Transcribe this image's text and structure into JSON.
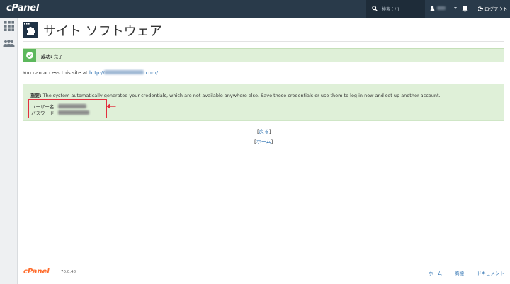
{
  "topbar": {
    "logo": "cPanel",
    "search_placeholder": "検索 ( / )",
    "logout_label": "ログアウト"
  },
  "page": {
    "title": "サイト ソフトウェア"
  },
  "alert_success": {
    "label": "成功:",
    "text": "完了"
  },
  "access": {
    "prefix": "You can access this site at ",
    "url_start": "http://",
    "url_end": ".com/"
  },
  "credentials": {
    "important_label": "重要:",
    "message": "The system automatically generated your credentials, which are not available anywhere else. Save these credentials or use them to log in now and set up another account.",
    "username_label": "ユーザー名:",
    "password_label": "パスワード:"
  },
  "links": {
    "back": "戻る",
    "home": "ホーム"
  },
  "footer": {
    "logo": "cPanel",
    "version": "70.0.48",
    "links": [
      "ホーム",
      "商標",
      "ドキュメント"
    ]
  },
  "colors": {
    "topbar": "#293a4a",
    "success_green": "#dff0d8",
    "highlight_red": "#e2303f",
    "link_blue": "#2a6fb0",
    "footer_logo_orange": "#ff6c2c"
  },
  "icons": [
    "search-icon",
    "user-icon",
    "bell-icon",
    "logout-icon",
    "grid-icon",
    "users-icon",
    "puzzle-icon",
    "check-icon",
    "arrow-left-icon"
  ]
}
